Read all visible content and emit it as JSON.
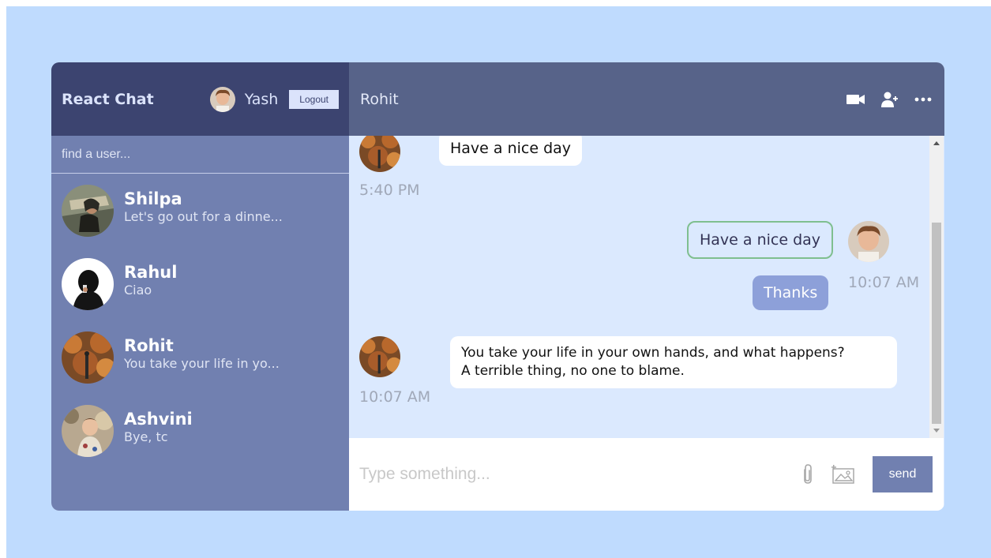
{
  "sidebar": {
    "logo": "React Chat",
    "user_name": "Yash",
    "logout_label": "Logout",
    "search_placeholder": "find a user...",
    "chats": [
      {
        "name": "Shilpa",
        "last_message": "Let's go out for a dinne..."
      },
      {
        "name": "Rahul",
        "last_message": "Ciao"
      },
      {
        "name": "Rohit",
        "last_message": "You take your life in yo..."
      },
      {
        "name": "Ashvini",
        "last_message": "Bye, tc"
      }
    ]
  },
  "chat": {
    "title": "Rohit",
    "icons": [
      "video-icon",
      "add-user-icon",
      "more-icon"
    ],
    "messages": [
      {
        "text": "Have a nice day",
        "time": "5:40 PM",
        "owner": false
      },
      {
        "text": "Have a nice day",
        "owner": true
      },
      {
        "text": "Thanks",
        "time": "10:07 AM",
        "owner": true
      },
      {
        "text_line1": "You take your life in your own hands, and what happens?",
        "text_line2": "A terrible thing, no one to blame.",
        "time": "10:07 AM",
        "owner": false
      }
    ],
    "input_placeholder": "Type something...",
    "send_label": "send"
  },
  "colors": {
    "background": "#bfdbfe",
    "nav": "#3c4470",
    "sidebar": "#7180b0",
    "chat_header": "#576389",
    "chat_bg": "#dbe9fe",
    "own_bubble": "#8da0d9",
    "outline_bubble_border": "#7fbf8f"
  }
}
